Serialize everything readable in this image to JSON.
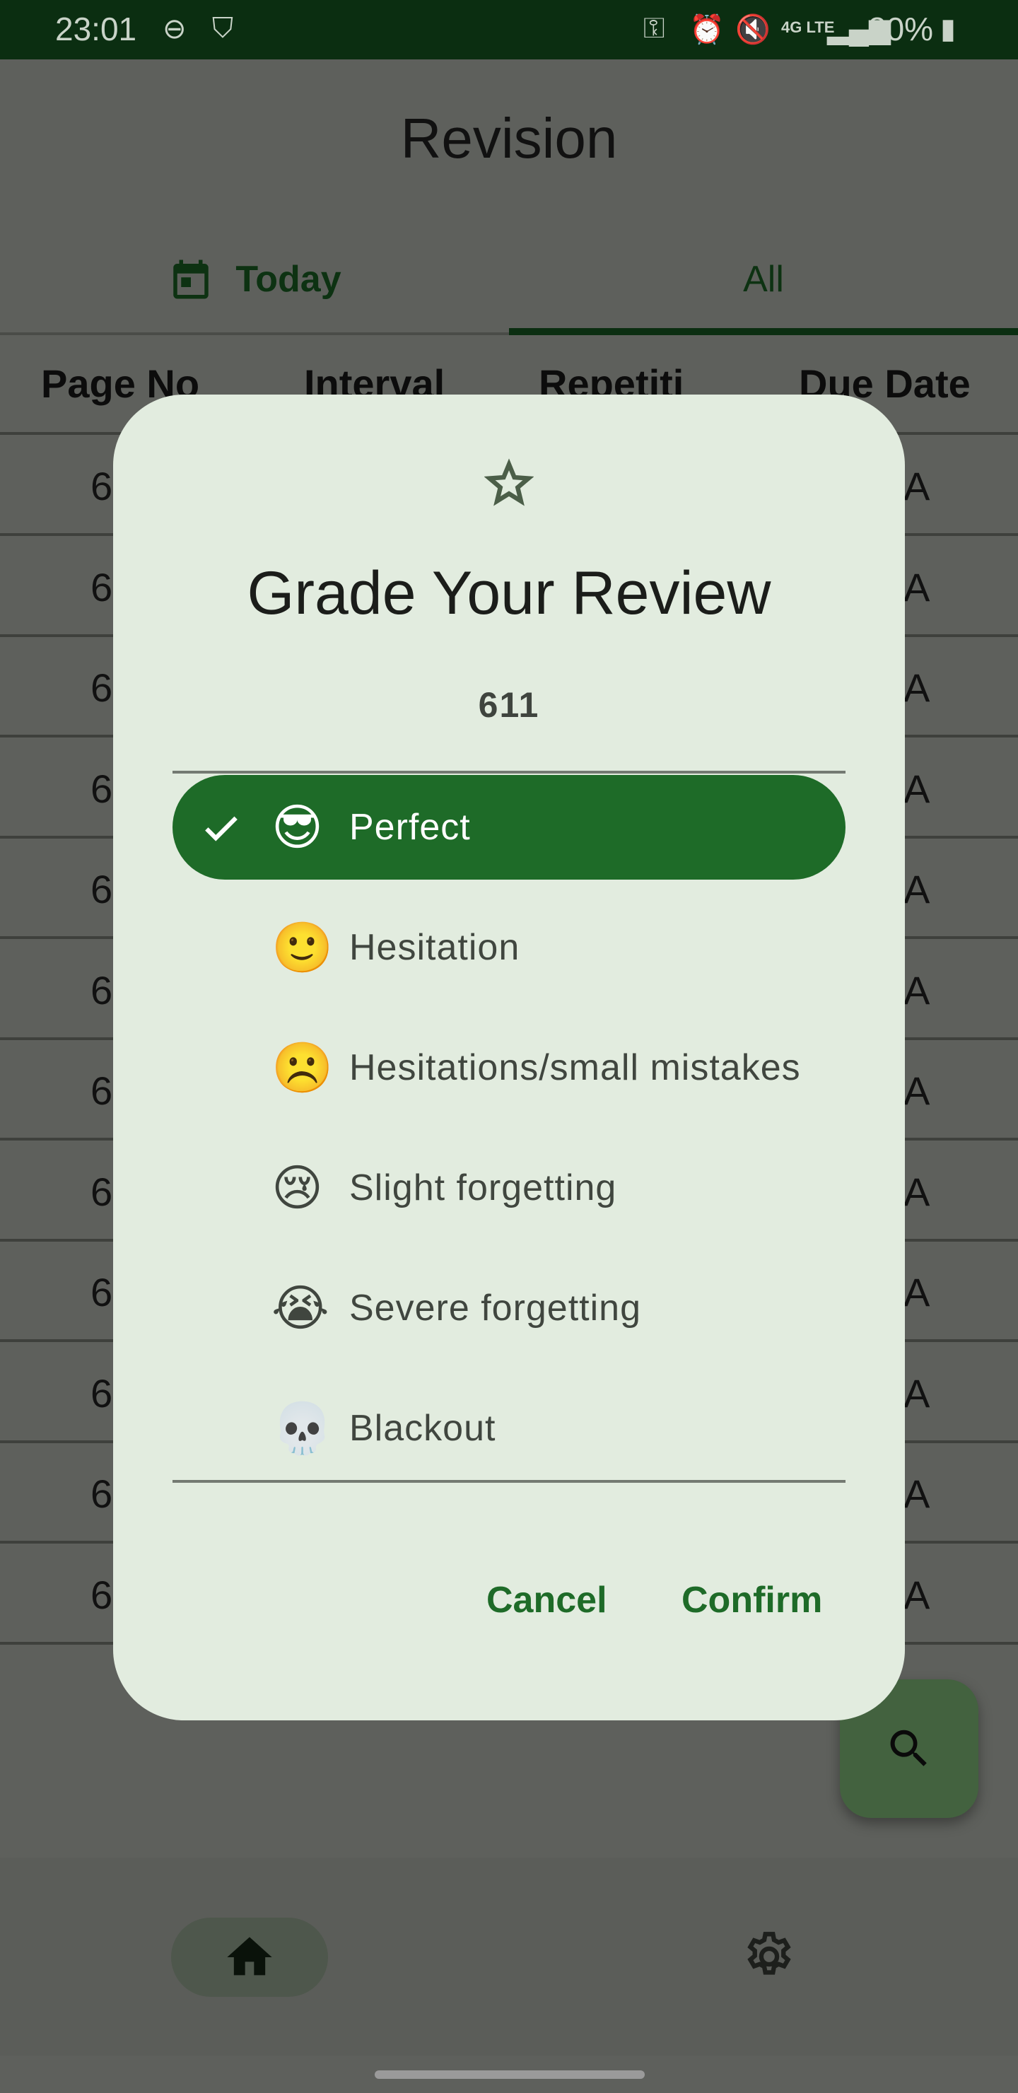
{
  "status_bar": {
    "time": "23:01",
    "battery": "80%",
    "network": "4G LTE"
  },
  "app": {
    "title": "Revision"
  },
  "tabs": [
    {
      "label": "Today",
      "icon": "calendar-icon",
      "selected": false
    },
    {
      "label": "All",
      "selected": true
    }
  ],
  "table": {
    "headers": [
      "Page No",
      "Interval",
      "Repetiti",
      "Due Date"
    ],
    "rows": [
      [
        "6",
        "A"
      ],
      [
        "6",
        "A"
      ],
      [
        "6",
        "A"
      ],
      [
        "6",
        "A"
      ],
      [
        "6",
        "A"
      ],
      [
        "6",
        "A"
      ],
      [
        "6",
        "A"
      ],
      [
        "6",
        "A"
      ],
      [
        "6",
        "A"
      ],
      [
        "6",
        "A"
      ],
      [
        "6",
        "A"
      ],
      [
        "6",
        "A"
      ]
    ]
  },
  "dialog": {
    "icon": "star-icon",
    "title": "Grade Your Review",
    "subtitle": "611",
    "options": [
      {
        "emoji": "😎",
        "label": "Perfect",
        "selected": true
      },
      {
        "emoji": "🙂",
        "label": "Hesitation",
        "selected": false
      },
      {
        "emoji": "☹️",
        "label": "Hesitations/small mistakes",
        "selected": false
      },
      {
        "emoji": "😢",
        "label": "Slight forgetting",
        "selected": false
      },
      {
        "emoji": "😭",
        "label": "Severe forgetting",
        "selected": false
      },
      {
        "emoji": "💀",
        "label": "Blackout",
        "selected": false
      }
    ],
    "cancel": "Cancel",
    "confirm": "Confirm"
  },
  "colors": {
    "accent": "#1e6b28",
    "status_bar": "#0b2e11",
    "dialog_bg": "#e2ecdf"
  }
}
